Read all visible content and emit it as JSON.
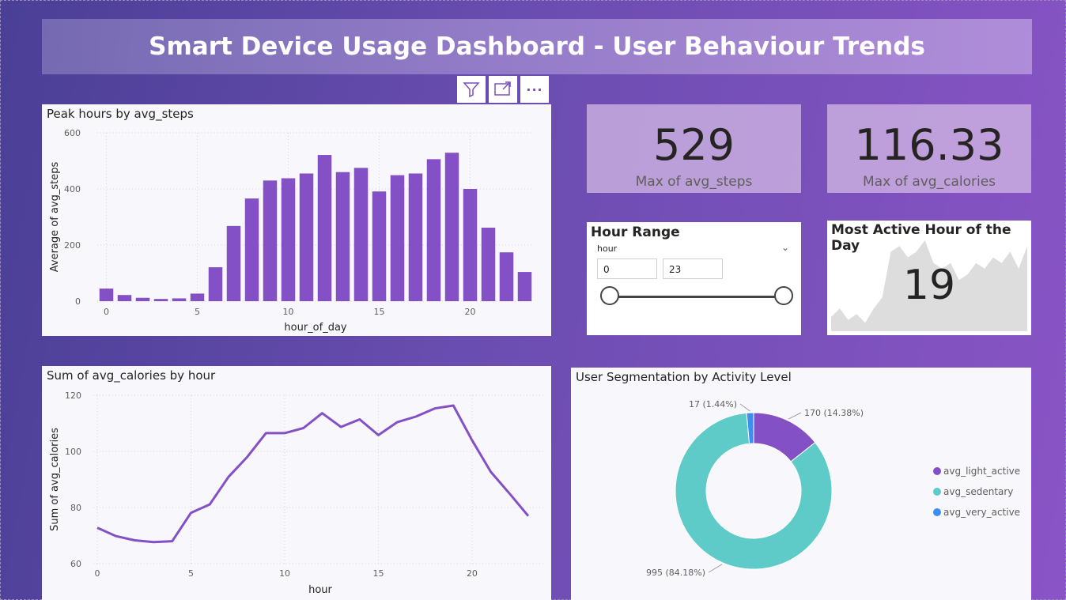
{
  "header": {
    "title": "Smart Device Usage Dashboard - User Behaviour Trends"
  },
  "toolbar": {
    "filter_icon": "filter-icon",
    "focus_icon": "focus-mode-icon",
    "more_icon": "more-options-icon",
    "more_label": "···"
  },
  "kpis": [
    {
      "value": "529",
      "label": "Max of avg_steps"
    },
    {
      "value": "116.33",
      "label": "Max of avg_calories"
    }
  ],
  "slicer": {
    "title": "Hour Range",
    "field": "hour",
    "min_value": "0",
    "max_value": "23",
    "range_min_fraction": 0,
    "range_max_fraction": 1
  },
  "most_active": {
    "title": "Most Active Hour of the Day",
    "value": "19",
    "sparkline": [
      5,
      8,
      4,
      6,
      3,
      8,
      12,
      28,
      30,
      26,
      28,
      32,
      24,
      22,
      24,
      18,
      20,
      24,
      22,
      26,
      24,
      28,
      22,
      30
    ]
  },
  "chart_data": [
    {
      "type": "bar",
      "title": "Peak hours by avg_steps",
      "xlabel": "hour_of_day",
      "ylabel": "Average of avg_steps",
      "x": [
        0,
        1,
        2,
        3,
        4,
        5,
        6,
        7,
        8,
        9,
        10,
        11,
        12,
        13,
        14,
        15,
        16,
        17,
        18,
        19,
        20,
        21,
        22,
        23
      ],
      "values": [
        45,
        22,
        12,
        8,
        10,
        27,
        121,
        268,
        366,
        430,
        438,
        455,
        521,
        460,
        475,
        391,
        449,
        455,
        506,
        529,
        400,
        262,
        174,
        104
      ],
      "ylim": [
        0,
        600
      ],
      "yticks": [
        0,
        200,
        400,
        600
      ],
      "xticks": [
        0,
        5,
        10,
        15,
        20
      ],
      "color": "#8350c6",
      "grid": true
    },
    {
      "type": "line",
      "title": "Sum of avg_calories by hour",
      "xlabel": "hour",
      "ylabel": "Sum of avg_calories",
      "x": [
        0,
        1,
        2,
        3,
        4,
        5,
        6,
        7,
        8,
        9,
        10,
        11,
        12,
        13,
        14,
        15,
        16,
        17,
        18,
        19,
        20,
        21,
        22,
        23
      ],
      "values": [
        72.8,
        69.8,
        68.3,
        67.7,
        68.0,
        78.1,
        81.1,
        90.9,
        98.0,
        106.5,
        106.5,
        108.3,
        113.6,
        108.7,
        111.4,
        105.8,
        110.4,
        112.4,
        115.3,
        116.33,
        104.0,
        92.7,
        85.0,
        77.0
      ],
      "ylim": [
        60,
        120
      ],
      "yticks": [
        60,
        80,
        100,
        120
      ],
      "xticks": [
        0,
        5,
        10,
        15,
        20
      ],
      "color": "#8350c6",
      "grid": true
    },
    {
      "type": "pie",
      "title": "User Segmentation by Activity Level",
      "categories": [
        "avg_light_active",
        "avg_sedentary",
        "avg_very_active"
      ],
      "values": [
        170,
        995,
        17
      ],
      "data_labels": [
        "170 (14.38%)",
        "995 (84.18%)",
        "17 (1.44%)"
      ],
      "colors": [
        "#8350c6",
        "#5ecbc8",
        "#3a8ff0"
      ],
      "legend": "right"
    }
  ]
}
